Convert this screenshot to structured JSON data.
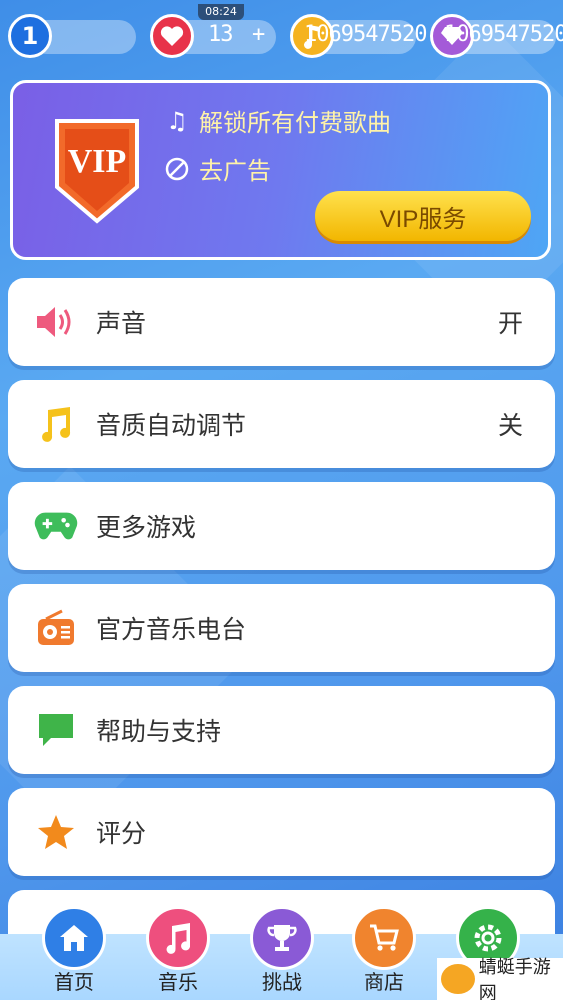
{
  "status_bar": {
    "time": "08:24"
  },
  "topbar": {
    "level": "1",
    "lives": "13",
    "lives_add": "+",
    "coins": "1069547520",
    "diamonds": "1069547520"
  },
  "vip": {
    "badge_text": "VIP",
    "line1": "解锁所有付费歌曲",
    "line2": "去广告",
    "button": "VIP服务"
  },
  "menu": [
    {
      "label": "声音",
      "value": "开",
      "icon": "speaker-icon"
    },
    {
      "label": "音质自动调节",
      "value": "关",
      "icon": "music-note-icon"
    },
    {
      "label": "更多游戏",
      "value": "",
      "icon": "gamepad-icon"
    },
    {
      "label": "官方音乐电台",
      "value": "",
      "icon": "radio-icon"
    },
    {
      "label": "帮助与支持",
      "value": "",
      "icon": "chat-bubble-icon"
    },
    {
      "label": "评分",
      "value": "",
      "icon": "star-icon"
    }
  ],
  "nav": [
    {
      "label": "首页",
      "icon": "home-icon"
    },
    {
      "label": "音乐",
      "icon": "music-icon"
    },
    {
      "label": "挑战",
      "icon": "trophy-icon"
    },
    {
      "label": "商店",
      "icon": "cart-icon"
    },
    {
      "label": "",
      "icon": "gear-icon"
    }
  ],
  "watermark": {
    "text": "蜻蜓手游网"
  },
  "colors": {
    "accent_gold": "#f2b600",
    "heart": "#e8334a",
    "coin": "#f5b320",
    "diamond": "#a45ad8"
  }
}
